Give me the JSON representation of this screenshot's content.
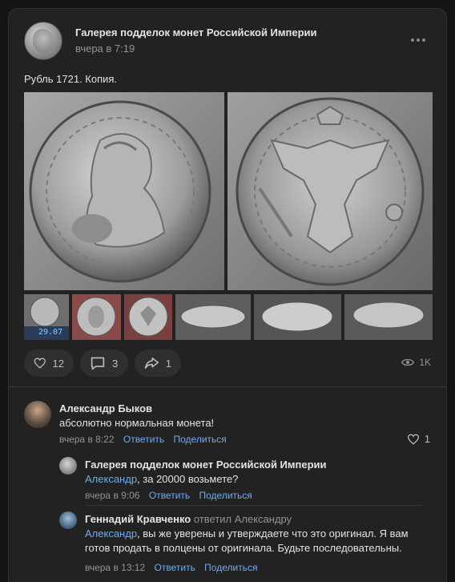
{
  "post": {
    "group_name": "Галерея подделок монет Российской Империи",
    "time": "вчера в 7:19",
    "text": "Рубль 1721. Копия.",
    "thumbnail_overlay": "29.07"
  },
  "actions": {
    "likes": "12",
    "comments": "3",
    "shares": "1",
    "views": "1K"
  },
  "comments": [
    {
      "author": "Александр Быков",
      "text": "абсолютно нормальная монета!",
      "time": "вчера в 8:22",
      "reply_label": "Ответить",
      "share_label": "Поделиться",
      "likes": "1"
    },
    {
      "author": "Галерея подделок монет Российской Империи",
      "mention": "Александр",
      "text": ", за 20000 возьмете?",
      "time": "вчера в 9:06",
      "reply_label": "Ответить",
      "share_label": "Поделиться"
    },
    {
      "author": "Геннадий Кравченко",
      "replied_to": "ответил Александру",
      "mention": "Александр",
      "text": ", вы же уверены и утверждаете что это оригинал. Я вам готов продать в полцены от оригинала. Будьте последовательны.",
      "time": "вчера в 13:12",
      "reply_label": "Ответить",
      "share_label": "Поделиться"
    }
  ],
  "colors": {
    "background": "#141414",
    "card": "#222222",
    "link": "#71aaeb",
    "muted": "#939393"
  },
  "icons": [
    "heart-icon",
    "comment-icon",
    "share-icon",
    "eye-icon",
    "more-icon"
  ]
}
